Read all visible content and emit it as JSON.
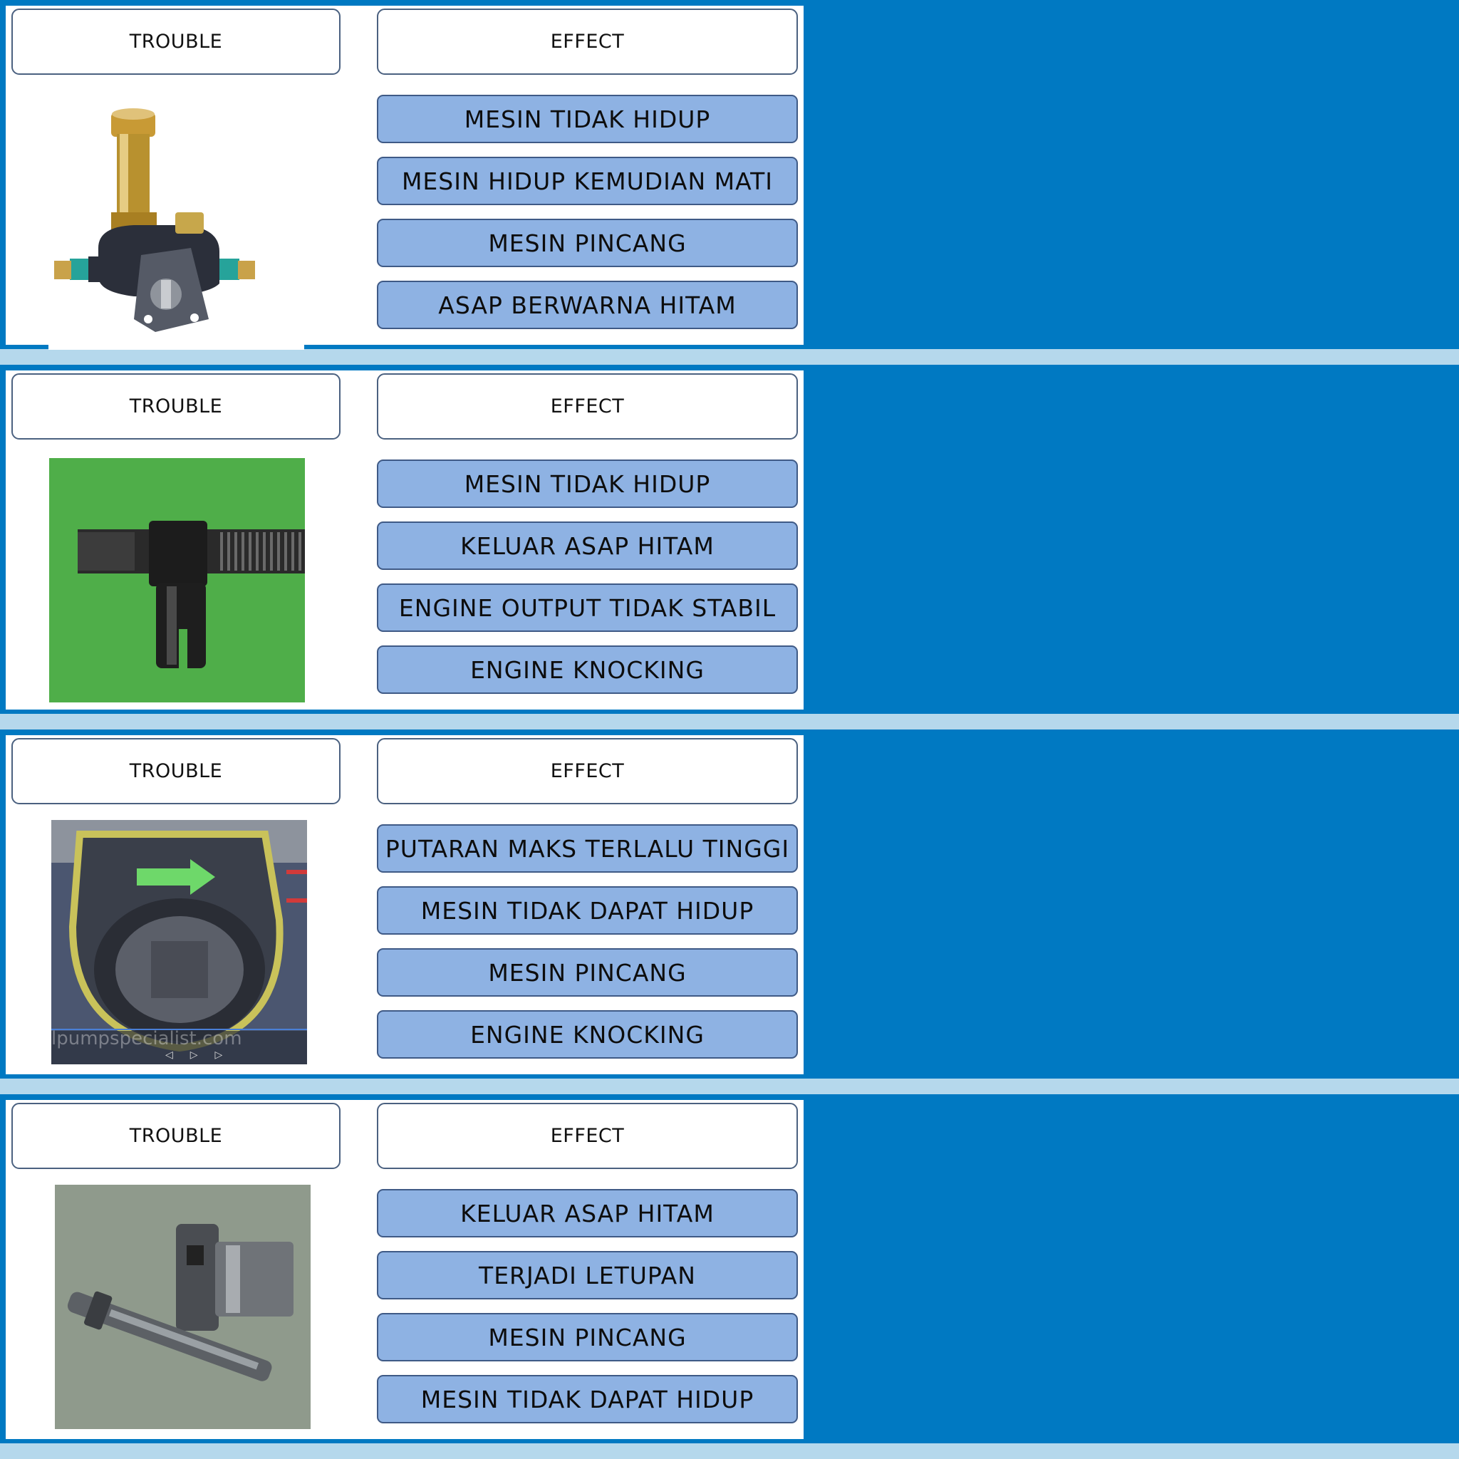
{
  "sections": [
    {
      "trouble_label": "TROUBLE",
      "effect_label": "EFFECT",
      "image": "fuel-feed-pump-photo",
      "options": [
        "MESIN TIDAK HIDUP",
        "MESIN HIDUP KEMUDIAN MATI",
        "MESIN PINCANG",
        "ASAP BERWARNA HITAM"
      ]
    },
    {
      "trouble_label": "TROUBLE",
      "effect_label": "EFFECT",
      "image": "control-rack-photo",
      "options": [
        "MESIN TIDAK HIDUP",
        "KELUAR ASAP HITAM",
        "ENGINE OUTPUT TIDAK STABIL",
        "ENGINE KNOCKING"
      ]
    },
    {
      "trouble_label": "TROUBLE",
      "effect_label": "EFFECT",
      "image": "injection-pump-housing-photo",
      "watermark": "lpumpspecialist.com",
      "options": [
        "PUTARAN MAKS TERLALU TINGGI",
        "MESIN TIDAK DAPAT HIDUP",
        "MESIN PINCANG",
        "ENGINE KNOCKING"
      ]
    },
    {
      "trouble_label": "TROUBLE",
      "effect_label": "EFFECT",
      "image": "plunger-barrel-photo",
      "options": [
        "KELUAR ASAP HITAM",
        "TERJADI LETUPAN",
        "MESIN PINCANG",
        "MESIN TIDAK DAPAT HIDUP"
      ]
    }
  ],
  "colors": {
    "panel_blue": "#0079c2",
    "separator_light_blue": "#b5d8ec",
    "option_fill": "#8eb2e3",
    "option_border": "#3f5a86"
  }
}
